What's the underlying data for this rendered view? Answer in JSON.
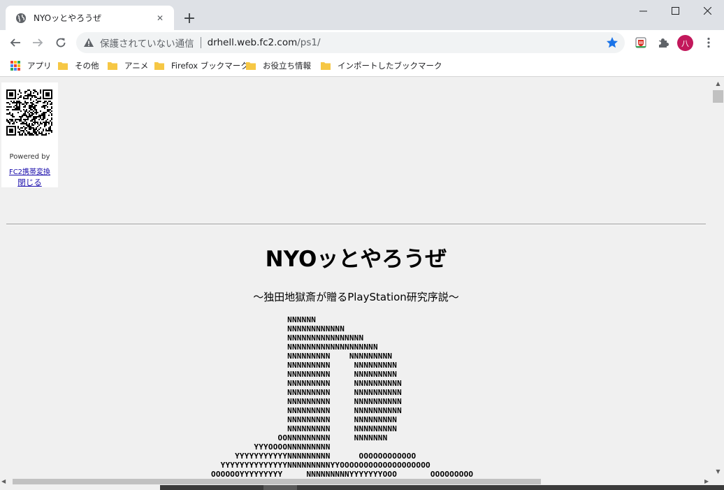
{
  "tab": {
    "title": "NYOッとやろうぜ",
    "close_glyph": "✕"
  },
  "new_tab_glyph": "+",
  "window_controls": {
    "minimize": "—",
    "maximize": "☐",
    "close": "✕"
  },
  "omnibox": {
    "security_label": "保護されていない通信",
    "url_host": "drhell.web.fc2.com",
    "url_path": "/ps1/"
  },
  "profile": {
    "avatar_letter": "八",
    "color": "#c2185b"
  },
  "bookmarks": [
    {
      "label": "アプリ",
      "icon": "apps-icon"
    },
    {
      "label": "その他",
      "icon": "folder-icon"
    },
    {
      "label": "アニメ",
      "icon": "folder-icon"
    },
    {
      "label": "Firefox ブックマーク",
      "icon": "folder-icon"
    },
    {
      "label": "お役立ち情報",
      "icon": "folder-icon"
    },
    {
      "label": "インポートしたブックマーク",
      "icon": "folder-icon"
    }
  ],
  "qr_panel": {
    "powered_by": "Powered by",
    "link_text": "FC2携帯変換",
    "close_text": "閉じる"
  },
  "page": {
    "title": "NYOッとやろうぜ",
    "subtitle": "～独田地獄斎が贈るPlayStation研究序説～",
    "ascii_art": "                NNNNNN\n                NNNNNNNNNNNN\n                NNNNNNNNNNNNNNNN\n                NNNNNNNNNNNNNNNNNNN\n                NNNNNNNNN    NNNNNNNNN\n                NNNNNNNNN     NNNNNNNNN\n                NNNNNNNNN     NNNNNNNNN\n                NNNNNNNNN     NNNNNNNNNN\n                NNNNNNNNN     NNNNNNNNNN\n                NNNNNNNNN     NNNNNNNNNN\n                NNNNNNNNN     NNNNNNNNNN\n                NNNNNNNNN     NNNNNNNNN\n                NNNNNNNNN     NNNNNNNNN\n              OONNNNNNNNN     NNNNNNN\n         YYYOOOONNNNNNNNN\n     YYYYYYYYYYYNNNNNNNNN      OOOOOOOOOOOO\n  YYYYYYYYYYYYYYNNNNNNNNNYYOOOOOOOOOOOOOOOOOOO\nOOOOOOYYYYYYYYY     NNNNNNNNNYYYYYYYOOO       OOOOOOOOO"
  },
  "accent_colors": {
    "star": "#1a73e8",
    "link": "#1a0dab",
    "folder": "#f6c744"
  }
}
